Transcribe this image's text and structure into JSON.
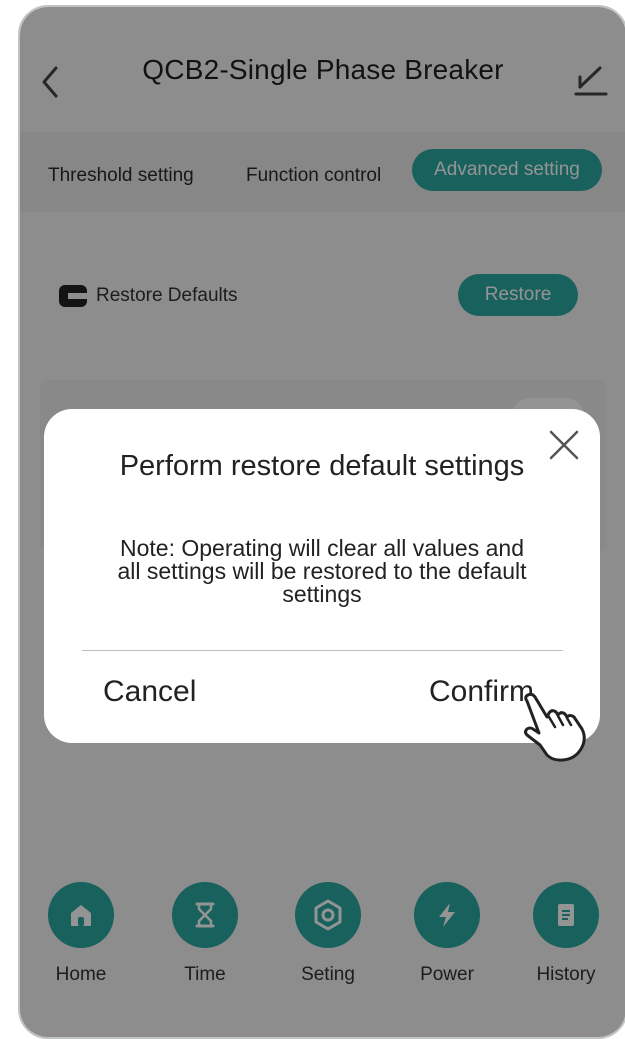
{
  "header": {
    "title": "QCB2-Single Phase Breaker",
    "back_icon": "chevron-left-icon",
    "edit_icon": "edit-pen-icon"
  },
  "tabs": [
    {
      "label": "Threshold setting",
      "active": false
    },
    {
      "label": "Function control",
      "active": false
    },
    {
      "label": "Advanced setting",
      "active": true
    }
  ],
  "restore_row": {
    "icon": "restore-icon",
    "label": "Restore Defaults",
    "button_label": "Restore"
  },
  "dialog": {
    "title": "Perform restore default settings",
    "note": "Note: Operating will clear all values and all settings will be restored to the default settings",
    "cancel_label": "Cancel",
    "confirm_label": "Confirm",
    "close_icon": "close-icon"
  },
  "bottom_nav": [
    {
      "label": "Home",
      "icon": "home-icon"
    },
    {
      "label": "Time",
      "icon": "hourglass-icon"
    },
    {
      "label": "Seting",
      "icon": "hexagon-settings-icon"
    },
    {
      "label": "Power",
      "icon": "lightning-icon"
    },
    {
      "label": "History",
      "icon": "document-icon"
    }
  ],
  "colors": {
    "accent": "#2aa8a0",
    "overlay": "rgba(0,0,0,0.42)",
    "dialog_bg": "#ffffff"
  }
}
